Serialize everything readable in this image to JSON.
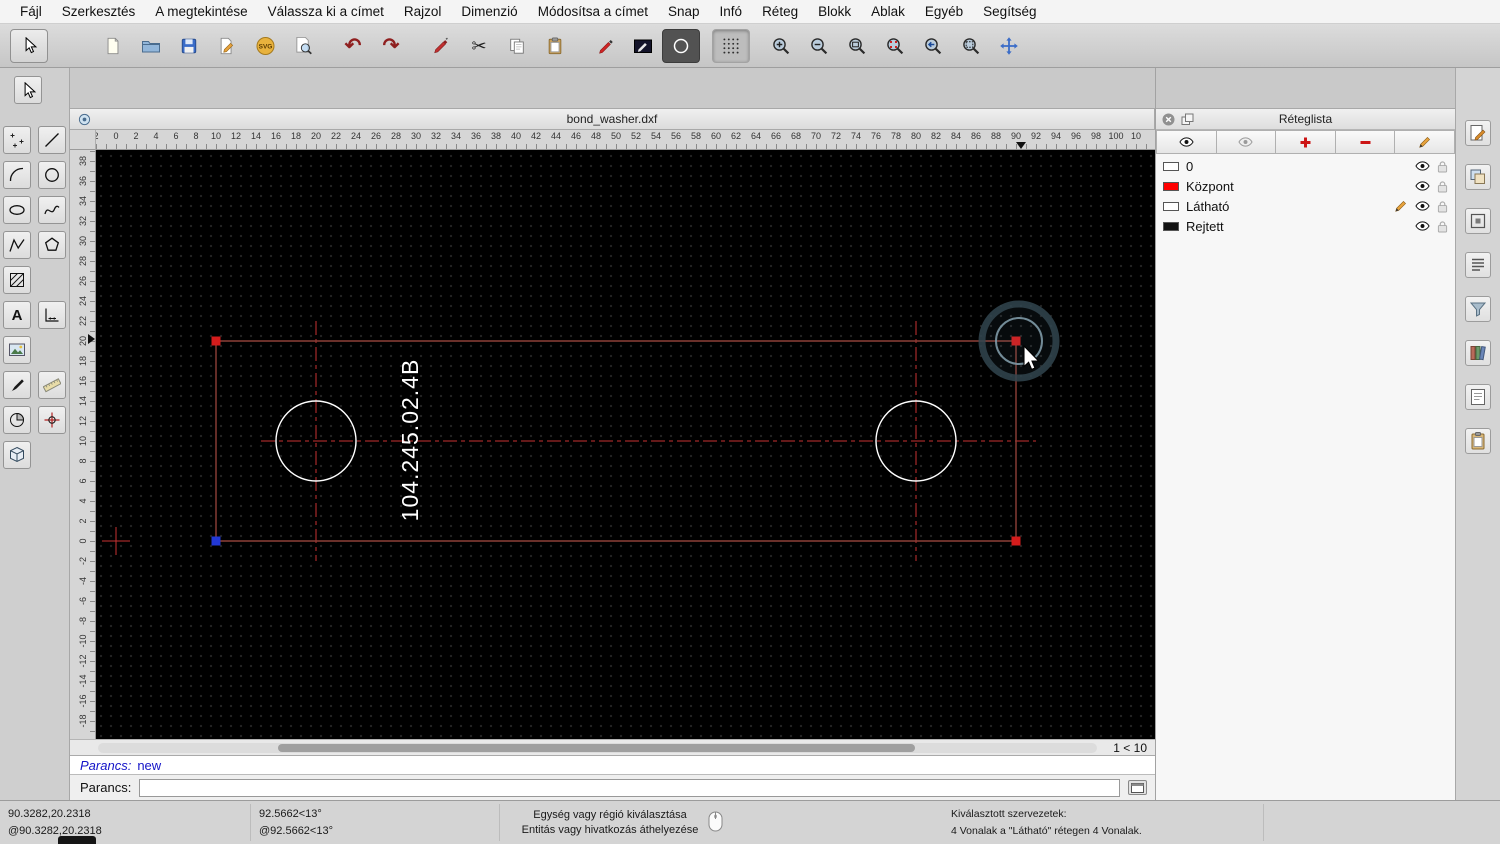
{
  "menubar": {
    "items": [
      "Fájl",
      "Szerkesztés",
      "A megtekintése",
      "Válassza ki a címet",
      "Rajzol",
      "Dimenzió",
      "Módosítsa a címet",
      "Snap",
      "Infó",
      "Réteg",
      "Blokk",
      "Ablak",
      "Egyéb",
      "Segítség"
    ]
  },
  "toolbar": {
    "buttons": [
      {
        "name": "select-arrow",
        "icon": "cursor",
        "group": 0
      },
      {
        "name": "new-file",
        "icon": "page",
        "group": 1
      },
      {
        "name": "open-file",
        "icon": "folder",
        "group": 1
      },
      {
        "name": "save-file",
        "icon": "floppy",
        "group": 1
      },
      {
        "name": "edit-drawing",
        "icon": "pagepen",
        "group": 1
      },
      {
        "name": "svg-export",
        "icon": "svgbadge",
        "group": 1
      },
      {
        "name": "print-preview",
        "icon": "preview",
        "group": 1
      },
      {
        "name": "undo",
        "icon": "undo",
        "group": 2
      },
      {
        "name": "redo",
        "icon": "redo",
        "group": 2
      },
      {
        "name": "pen-edit",
        "icon": "pen",
        "group": 3
      },
      {
        "name": "cut",
        "icon": "scissors",
        "group": 3
      },
      {
        "name": "copy",
        "icon": "copy",
        "group": 3
      },
      {
        "name": "paste",
        "icon": "clipboard",
        "group": 3
      },
      {
        "name": "attributes-pen",
        "icon": "penred",
        "group": 4
      },
      {
        "name": "entity-attributes",
        "icon": "boxpen",
        "group": 4
      },
      {
        "name": "current-pen-circle",
        "icon": "circle",
        "group": 4,
        "state": "active"
      },
      {
        "name": "grid-snap",
        "icon": "grid",
        "group": 5,
        "state": "pressed"
      },
      {
        "name": "zoom-in",
        "icon": "zoomin",
        "group": 6
      },
      {
        "name": "zoom-out",
        "icon": "zoomout",
        "group": 6
      },
      {
        "name": "zoom-auto",
        "icon": "zoomauto",
        "group": 6
      },
      {
        "name": "zoom-redraw",
        "icon": "zoomredraw",
        "group": 6
      },
      {
        "name": "zoom-previous",
        "icon": "zoomprev",
        "group": 6
      },
      {
        "name": "zoom-window",
        "icon": "zoomwindow",
        "group": 6
      },
      {
        "name": "pan-view",
        "icon": "pan",
        "group": 6
      }
    ]
  },
  "palette": {
    "buttons": [
      {
        "name": "tool-points",
        "icon": "points"
      },
      {
        "name": "tool-line",
        "icon": "line"
      },
      {
        "name": "tool-arc",
        "icon": "arc"
      },
      {
        "name": "tool-circle",
        "icon": "circle2"
      },
      {
        "name": "tool-ellipse",
        "icon": "ellipse"
      },
      {
        "name": "tool-spline",
        "icon": "spline"
      },
      {
        "name": "tool-polyline",
        "icon": "polyline"
      },
      {
        "name": "tool-polygon",
        "icon": "polygon"
      },
      {
        "name": "tool-hatch",
        "icon": "hatch"
      },
      {
        "name": "spacer",
        "icon": "spacer"
      },
      {
        "name": "tool-text",
        "icon": "textA"
      },
      {
        "name": "tool-dimension",
        "icon": "dim"
      },
      {
        "name": "tool-image",
        "icon": "image"
      },
      {
        "name": "spacer",
        "icon": "spacer"
      },
      {
        "name": "tool-modify",
        "icon": "brush"
      },
      {
        "name": "tool-measure",
        "icon": "rulericon"
      },
      {
        "name": "tool-info",
        "icon": "sector"
      },
      {
        "name": "tool-snap",
        "icon": "snapcross"
      },
      {
        "name": "tool-block",
        "icon": "cube"
      }
    ]
  },
  "doc": {
    "title": "bond_washer.dxf"
  },
  "rulers": {
    "h_labels": [
      "2",
      "0",
      "2",
      "4",
      "6",
      "8",
      "10",
      "12",
      "14",
      "16",
      "18",
      "20",
      "22",
      "24",
      "26",
      "28",
      "30",
      "32",
      "34",
      "36",
      "38",
      "40",
      "42",
      "44",
      "46",
      "48",
      "50",
      "52",
      "54",
      "56",
      "58",
      "60",
      "62",
      "64",
      "66",
      "68",
      "70",
      "72",
      "74",
      "76",
      "78",
      "80",
      "82",
      "84",
      "86",
      "88",
      "90",
      "92",
      "94",
      "96",
      "98",
      "100",
      "10"
    ],
    "v_labels": [
      "38",
      "36",
      "34",
      "32",
      "30",
      "28",
      "26",
      "24",
      "22",
      "20",
      "18",
      "16",
      "14",
      "12",
      "10",
      "8",
      "6",
      "4",
      "2",
      "0",
      "-2",
      "-4",
      "-6",
      "-8",
      "-10",
      "-12",
      "-14",
      "-16",
      "-18"
    ]
  },
  "canvas": {
    "part_label": "104.245.02.4B",
    "page_indicator": "1 < 10",
    "entity_color": "#8e4038",
    "centerline_color": "#c83232",
    "hole_color": "#ffffff",
    "grip_red": "#d51c1c",
    "grip_blue": "#2238d5"
  },
  "layer_panel": {
    "title": "Réteglista",
    "toolbar": [
      {
        "name": "show-all-layers",
        "icon": "eye"
      },
      {
        "name": "hide-all-layers",
        "icon": "eyegray"
      },
      {
        "name": "add-layer",
        "icon": "plusred"
      },
      {
        "name": "remove-layer",
        "icon": "minusred"
      },
      {
        "name": "modify-layer",
        "icon": "pencil"
      }
    ],
    "layers": [
      {
        "name": "0",
        "color": "#ffffff",
        "current": false
      },
      {
        "name": "Központ",
        "color": "#ff0000",
        "current": false
      },
      {
        "name": "Látható",
        "color": "#ffffff",
        "current": true
      },
      {
        "name": "Rejtett",
        "color": "#111111",
        "current": false
      }
    ]
  },
  "dock": {
    "buttons": [
      {
        "name": "dock-pen-palette",
        "icon": "dockpen"
      },
      {
        "name": "dock-layer-list",
        "icon": "docklayers"
      },
      {
        "name": "dock-block-list",
        "icon": "dockblock"
      },
      {
        "name": "dock-entity-list",
        "icon": "docklist"
      },
      {
        "name": "dock-layer-filter",
        "icon": "dockfilter"
      },
      {
        "name": "dock-library-browser",
        "icon": "docklib"
      },
      {
        "name": "dock-command-notes",
        "icon": "docknotes"
      },
      {
        "name": "dock-clipboard",
        "icon": "dockclip"
      }
    ]
  },
  "command": {
    "history_label": "Parancs:",
    "history_entry": "new",
    "prompt_label": "Parancs:",
    "input_value": ""
  },
  "statusbar": {
    "abs_coords": "90.3282,20.2318",
    "rel_coords": "@90.3282,20.2318",
    "abs_polar": "92.5662<13°",
    "rel_polar": "@92.5662<13°",
    "hint_primary": "Egység vagy régió kiválasztása",
    "hint_secondary": "Entitás vagy hivatkozás áthelyezése",
    "selection_title": "Kiválasztott szervezetek:",
    "selection_detail": "4 Vonalak a \"Látható\" rétegen 4 Vonalak."
  }
}
